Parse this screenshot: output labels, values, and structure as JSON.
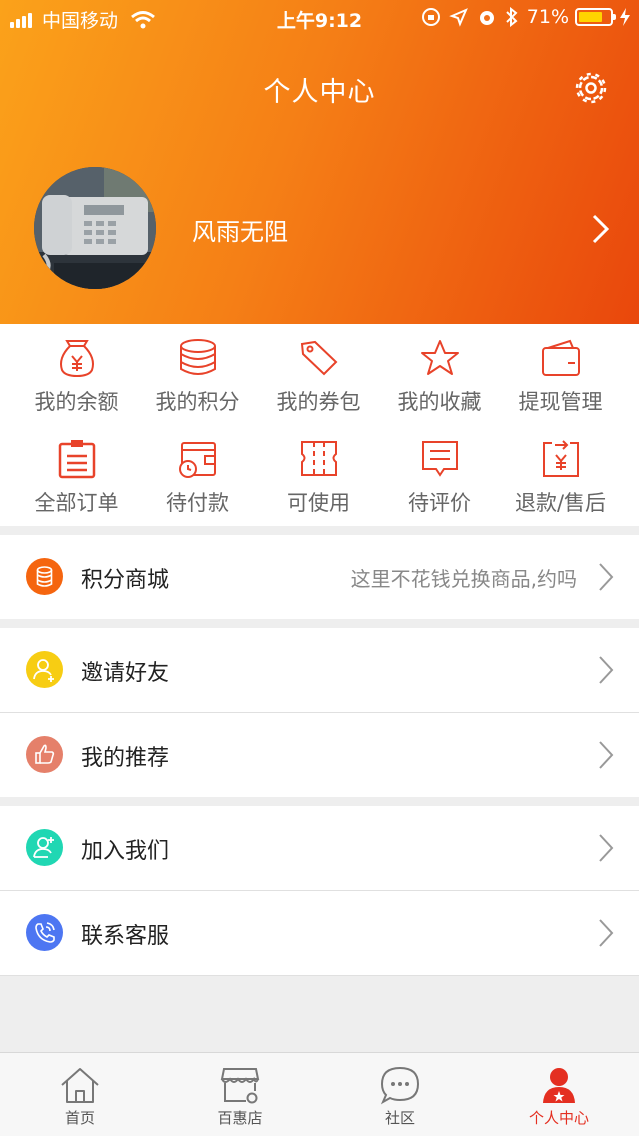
{
  "status_bar": {
    "carrier": "中国移动",
    "time": "上午9:12",
    "battery": "71%"
  },
  "header": {
    "title": "个人中心",
    "username": "风雨无阻"
  },
  "quick_actions": [
    {
      "label": "我的余额",
      "icon": "money-bag-icon"
    },
    {
      "label": "我的积分",
      "icon": "coins-stack-icon"
    },
    {
      "label": "我的券包",
      "icon": "tag-icon"
    },
    {
      "label": "我的收藏",
      "icon": "star-icon"
    },
    {
      "label": "提现管理",
      "icon": "wallet-icon"
    }
  ],
  "order_actions": [
    {
      "label": "全部订单",
      "icon": "clipboard-icon"
    },
    {
      "label": "待付款",
      "icon": "wallet-clock-icon"
    },
    {
      "label": "可使用",
      "icon": "ticket-icon"
    },
    {
      "label": "待评价",
      "icon": "comment-icon"
    },
    {
      "label": "退款/售后",
      "icon": "refund-icon"
    }
  ],
  "menu": {
    "points_mall": {
      "label": "积分商城",
      "hint": "这里不花钱兑换商品,约吗",
      "icon": "coins-icon",
      "color": "#f5650f"
    },
    "invite": {
      "label": "邀请好友",
      "icon": "user-add-icon",
      "color": "#f7cd13"
    },
    "recommend": {
      "label": "我的推荐",
      "icon": "thumbs-up-icon",
      "color": "#e5806a"
    },
    "join": {
      "label": "加入我们",
      "icon": "user-plus-icon",
      "color": "#20d7b3"
    },
    "service": {
      "label": "联系客服",
      "icon": "phone-icon",
      "color": "#4d76f2"
    }
  },
  "tabbar": [
    {
      "label": "首页",
      "icon": "home-icon"
    },
    {
      "label": "百惠店",
      "icon": "store-icon"
    },
    {
      "label": "社区",
      "icon": "chat-bubble-icon"
    },
    {
      "label": "个人中心",
      "icon": "person-icon",
      "active": true
    }
  ],
  "colors": {
    "accent": "#e8432a",
    "header_start": "#fba21a",
    "header_end": "#e9470c"
  }
}
